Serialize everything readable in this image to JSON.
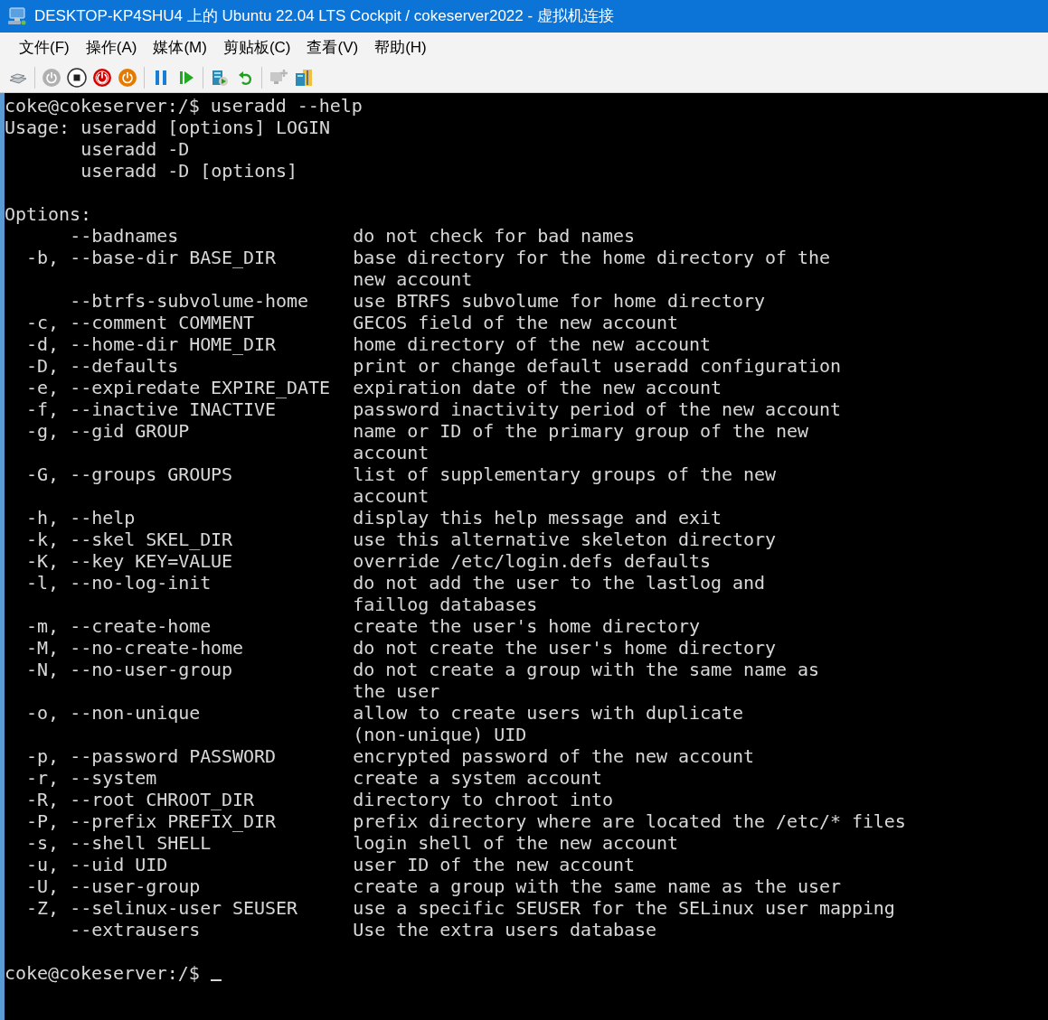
{
  "window": {
    "title": "DESKTOP-KP4SHU4 上的 Ubuntu 22.04 LTS Cockpit / cokeserver2022 - 虚拟机连接"
  },
  "menu": [
    "文件(F)",
    "操作(A)",
    "媒体(M)",
    "剪贴板(C)",
    "查看(V)",
    "帮助(H)"
  ],
  "terminal": {
    "header": [
      {
        "kind": "text",
        "text": "coke@cokeserver:/$ useradd --help"
      },
      {
        "kind": "usage",
        "label": "Usage:",
        "text": "useradd [options] LOGIN"
      },
      {
        "kind": "usage",
        "text": "useradd -D"
      },
      {
        "kind": "usage",
        "text": "useradd -D [options]"
      },
      {
        "kind": "blank"
      },
      {
        "kind": "text",
        "text": "Options:"
      }
    ],
    "options": [
      {
        "long": "--badnames",
        "description": "do not check for bad names"
      },
      {
        "short": "-b,",
        "long": "--base-dir BASE_DIR",
        "description": "base directory for the home directory of the"
      },
      {
        "description": "new account"
      },
      {
        "long": "--btrfs-subvolume-home",
        "description": "use BTRFS subvolume for home directory"
      },
      {
        "short": "-c,",
        "long": "--comment COMMENT",
        "description": "GECOS field of the new account"
      },
      {
        "short": "-d,",
        "long": "--home-dir HOME_DIR",
        "description": "home directory of the new account"
      },
      {
        "short": "-D,",
        "long": "--defaults",
        "description": "print or change default useradd configuration"
      },
      {
        "short": "-e,",
        "long": "--expiredate EXPIRE_DATE",
        "description": "expiration date of the new account"
      },
      {
        "short": "-f,",
        "long": "--inactive INACTIVE",
        "description": "password inactivity period of the new account"
      },
      {
        "short": "-g,",
        "long": "--gid GROUP",
        "description": "name or ID of the primary group of the new"
      },
      {
        "description": "account"
      },
      {
        "short": "-G,",
        "long": "--groups GROUPS",
        "description": "list of supplementary groups of the new"
      },
      {
        "description": "account"
      },
      {
        "short": "-h,",
        "long": "--help",
        "description": "display this help message and exit"
      },
      {
        "short": "-k,",
        "long": "--skel SKEL_DIR",
        "description": "use this alternative skeleton directory"
      },
      {
        "short": "-K,",
        "long": "--key KEY=VALUE",
        "description": "override /etc/login.defs defaults"
      },
      {
        "short": "-l,",
        "long": "--no-log-init",
        "description": "do not add the user to the lastlog and"
      },
      {
        "description": "faillog databases"
      },
      {
        "short": "-m,",
        "long": "--create-home",
        "description": "create the user's home directory"
      },
      {
        "short": "-M,",
        "long": "--no-create-home",
        "description": "do not create the user's home directory"
      },
      {
        "short": "-N,",
        "long": "--no-user-group",
        "description": "do not create a group with the same name as"
      },
      {
        "description": "the user"
      },
      {
        "short": "-o,",
        "long": "--non-unique",
        "description": "allow to create users with duplicate"
      },
      {
        "description": "(non-unique) UID"
      },
      {
        "short": "-p,",
        "long": "--password PASSWORD",
        "description": "encrypted password of the new account"
      },
      {
        "short": "-r,",
        "long": "--system",
        "description": "create a system account"
      },
      {
        "short": "-R,",
        "long": "--root CHROOT_DIR",
        "description": "directory to chroot into"
      },
      {
        "short": "-P,",
        "long": "--prefix PREFIX_DIR",
        "description": "prefix directory where are located the /etc/* files"
      },
      {
        "short": "-s,",
        "long": "--shell SHELL",
        "description": "login shell of the new account"
      },
      {
        "short": "-u,",
        "long": "--uid UID",
        "description": "user ID of the new account"
      },
      {
        "short": "-U,",
        "long": "--user-group",
        "description": "create a group with the same name as the user"
      },
      {
        "short": "-Z,",
        "long": "--selinux-user SEUSER",
        "description": "use a specific SEUSER for the SELinux user mapping"
      },
      {
        "long": "--extrausers",
        "description": "Use the extra users database"
      }
    ],
    "prompt": {
      "text": "coke@cokeserver:/$",
      "cursor": true
    }
  }
}
